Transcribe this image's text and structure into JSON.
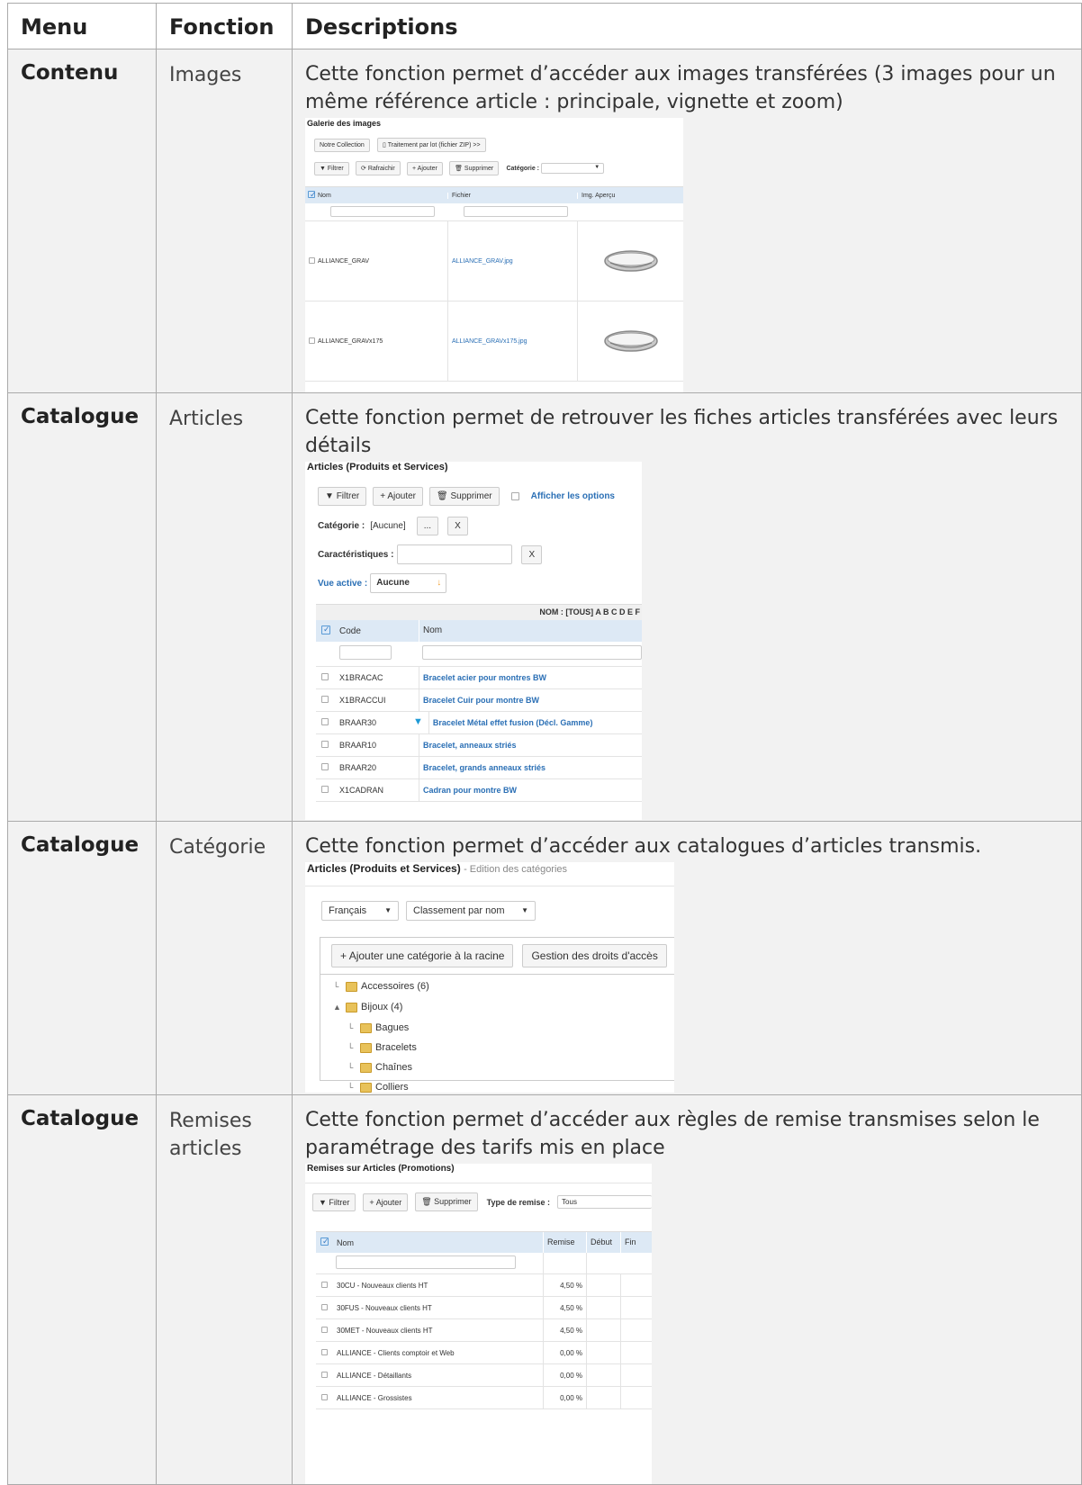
{
  "headers": {
    "menu": "Menu",
    "fonction": "Fonction",
    "descriptions": "Descriptions"
  },
  "rows": [
    {
      "menu": "Contenu",
      "fonction": "Images",
      "description": "Cette fonction permet d’accéder aux images transférées (3 images pour un même référence article : principale, vignette et zoom)"
    },
    {
      "menu": "Catalogue",
      "fonction": "Articles",
      "description": "Cette fonction permet de retrouver les fiches articles transférées avec leurs détails"
    },
    {
      "menu": "Catalogue",
      "fonction": "Catégorie",
      "description": "Cette fonction permet d’accéder aux catalogues d’articles transmis."
    },
    {
      "menu": "Catalogue",
      "fonction": "Remises articles",
      "description": "Cette fonction permet d’accéder aux règles de remise transmises selon le paramétrage des tarifs mis en place"
    }
  ],
  "shot1": {
    "title": "Galerie des images",
    "btn_collection": "Notre Collection",
    "btn_lot": "Traitement par lot (fichier ZIP) >>",
    "btn_filtrer": "Filtrer",
    "btn_rafraichir": "Rafraichir",
    "btn_ajouter": "Ajouter",
    "btn_supprimer": "Supprimer",
    "categorie_label": "Catégorie :",
    "col_nom": "Nom",
    "col_fichier": "Fichier",
    "col_apercu": "Img. Aperçu",
    "items": [
      {
        "nom": "ALLIANCE_GRAV",
        "fichier": "ALLIANCE_GRAV.jpg"
      },
      {
        "nom": "ALLIANCE_GRAVx175",
        "fichier": "ALLIANCE_GRAVx175.jpg"
      }
    ]
  },
  "shot2": {
    "title": "Articles (Produits et Services)",
    "btn_filtrer": "Filtrer",
    "btn_ajouter": "Ajouter",
    "btn_supprimer": "Supprimer",
    "afficher_options": "Afficher les options",
    "categorie_label": "Catégorie :",
    "categorie_value": "[Aucune]",
    "btn_dots": "...",
    "btn_x": "X",
    "caracteristiques_label": "Caractéristiques :",
    "vue_label": "Vue active :",
    "vue_value": "Aucune",
    "alpha_bar": "NOM : [TOUS] A B C D E F",
    "col_code": "Code",
    "col_nom": "Nom",
    "items": [
      {
        "code": "X1BRACAC",
        "nom": "Bracelet acier pour montres BW"
      },
      {
        "code": "X1BRACCUI",
        "nom": "Bracelet Cuir pour montre BW"
      },
      {
        "code": "BRAAR30",
        "nom": "Bracelet Métal effet fusion (Décl. Gamme)"
      },
      {
        "code": "BRAAR10",
        "nom": "Bracelet, anneaux striés"
      },
      {
        "code": "BRAAR20",
        "nom": "Bracelet, grands anneaux striés"
      },
      {
        "code": "X1CADRAN",
        "nom": "Cadran pour montre BW"
      }
    ]
  },
  "shot3": {
    "title": "Articles (Produits et Services)",
    "subtitle": "- Edition des catégories",
    "lang_value": "Français",
    "sort_value": "Classement par nom",
    "btn_ajouter_racine": "Ajouter une catégorie à la racine",
    "btn_droits": "Gestion des droits d'accès",
    "tree": [
      {
        "label": "Accessoires (6)",
        "level": 0
      },
      {
        "label": "Bijoux (4)",
        "level": 0
      },
      {
        "label": "Bagues",
        "level": 1
      },
      {
        "label": "Bracelets",
        "level": 1
      },
      {
        "label": "Chaînes",
        "level": 1
      },
      {
        "label": "Colliers",
        "level": 1
      }
    ]
  },
  "shot4": {
    "title": "Remises sur Articles (Promotions)",
    "btn_filtrer": "Filtrer",
    "btn_ajouter": "Ajouter",
    "btn_supprimer": "Supprimer",
    "type_label": "Type de remise :",
    "type_value": "Tous",
    "col_nom": "Nom",
    "col_remise": "Remise",
    "col_debut": "Début",
    "col_fin": "Fin",
    "items": [
      {
        "nom": "30CU - Nouveaux clients HT",
        "remise": "4,50 %"
      },
      {
        "nom": "30FUS - Nouveaux clients HT",
        "remise": "4,50 %"
      },
      {
        "nom": "30MET - Nouveaux clients HT",
        "remise": "4,50 %"
      },
      {
        "nom": "ALLIANCE - Clients comptoir et Web",
        "remise": "0,00 %"
      },
      {
        "nom": "ALLIANCE - Détaillants",
        "remise": "0,00 %"
      },
      {
        "nom": "ALLIANCE - Grossistes",
        "remise": "0,00 %"
      }
    ]
  }
}
